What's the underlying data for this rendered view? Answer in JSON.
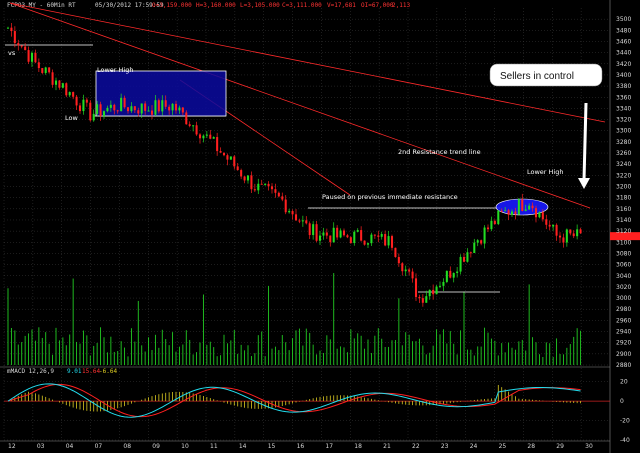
{
  "header": {
    "symbol": "FCPO3.MY - 60Min RT",
    "datetime": "05/30/2012 17:59:59",
    "open": "O=3,159.000",
    "high": "H=3,160.000",
    "low": "L=3,105.000",
    "close": "C=3,111.000",
    "volume": "V=17,681",
    "open_interest": "OI=67,000",
    "change": "2,113"
  },
  "colors": {
    "background": "#000000",
    "up_candle": "#22dd22",
    "down_candle": "#ff2020",
    "grid": "#3a3a3a",
    "trendline": "#ff2a2a",
    "volume": "#22cc22",
    "macd_line": "#22ddee",
    "signal_line": "#ff2020",
    "histogram": "#ddcc22",
    "box_fill": "#0a0aa0",
    "oval_fill": "#1a1aff",
    "current_price": "#ff2020"
  },
  "annotations": {
    "vs": "vs",
    "lower_high_1": "Lower High",
    "low": "Low",
    "paused": "Paused on previous immediate resistance",
    "resistance": "2nd Resistance trend line",
    "lower_high_2": "Lower High",
    "callout": "Sellers in control"
  },
  "chart_data": [
    {
      "type": "candlestick",
      "title": "FCPO3.MY - 60Min RT",
      "x_labels": [
        "12",
        "03",
        "04",
        "07",
        "08",
        "09",
        "10",
        "11",
        "14",
        "15",
        "16",
        "17",
        "18",
        "21",
        "22",
        "23",
        "24",
        "25",
        "28",
        "29",
        "30"
      ],
      "ylim": [
        2880,
        3520
      ],
      "y_ticks": [
        2880,
        2900,
        2920,
        2940,
        2960,
        2980,
        3000,
        3020,
        3040,
        3060,
        3080,
        3100,
        3120,
        3140,
        3160,
        3180,
        3200,
        3220,
        3240,
        3260,
        3280,
        3300,
        3320,
        3340,
        3360,
        3380,
        3400,
        3420,
        3440,
        3460,
        3480,
        3500
      ],
      "current_price": 3111,
      "grid": true,
      "price_path": [
        [
          "12",
          3485
        ],
        [
          "03",
          3420
        ],
        [
          "04",
          3380
        ],
        [
          "07",
          3330
        ],
        [
          "08",
          3345
        ],
        [
          "09",
          3340
        ],
        [
          "10",
          3345
        ],
        [
          "11",
          3300
        ],
        [
          "14",
          3250
        ],
        [
          "15",
          3200
        ],
        [
          "16",
          3175
        ],
        [
          "17",
          3120
        ],
        [
          "18",
          3110
        ],
        [
          "21",
          3110
        ],
        [
          "22",
          3100
        ],
        [
          "23",
          3000
        ],
        [
          "24",
          3040
        ],
        [
          "25",
          3100
        ],
        [
          "28",
          3150
        ],
        [
          "29",
          3175
        ],
        [
          "30",
          3111
        ]
      ]
    },
    {
      "type": "bar",
      "title": "Volume",
      "note": "volume histogram under the price panel"
    },
    {
      "type": "line",
      "title": "mMACD 12,26,9",
      "values_label": [
        "9.01",
        "15.64",
        "-6.64"
      ],
      "ylim": [
        -40,
        40
      ],
      "y_ticks": [
        20,
        0,
        -20,
        -40
      ],
      "grid": true
    }
  ]
}
